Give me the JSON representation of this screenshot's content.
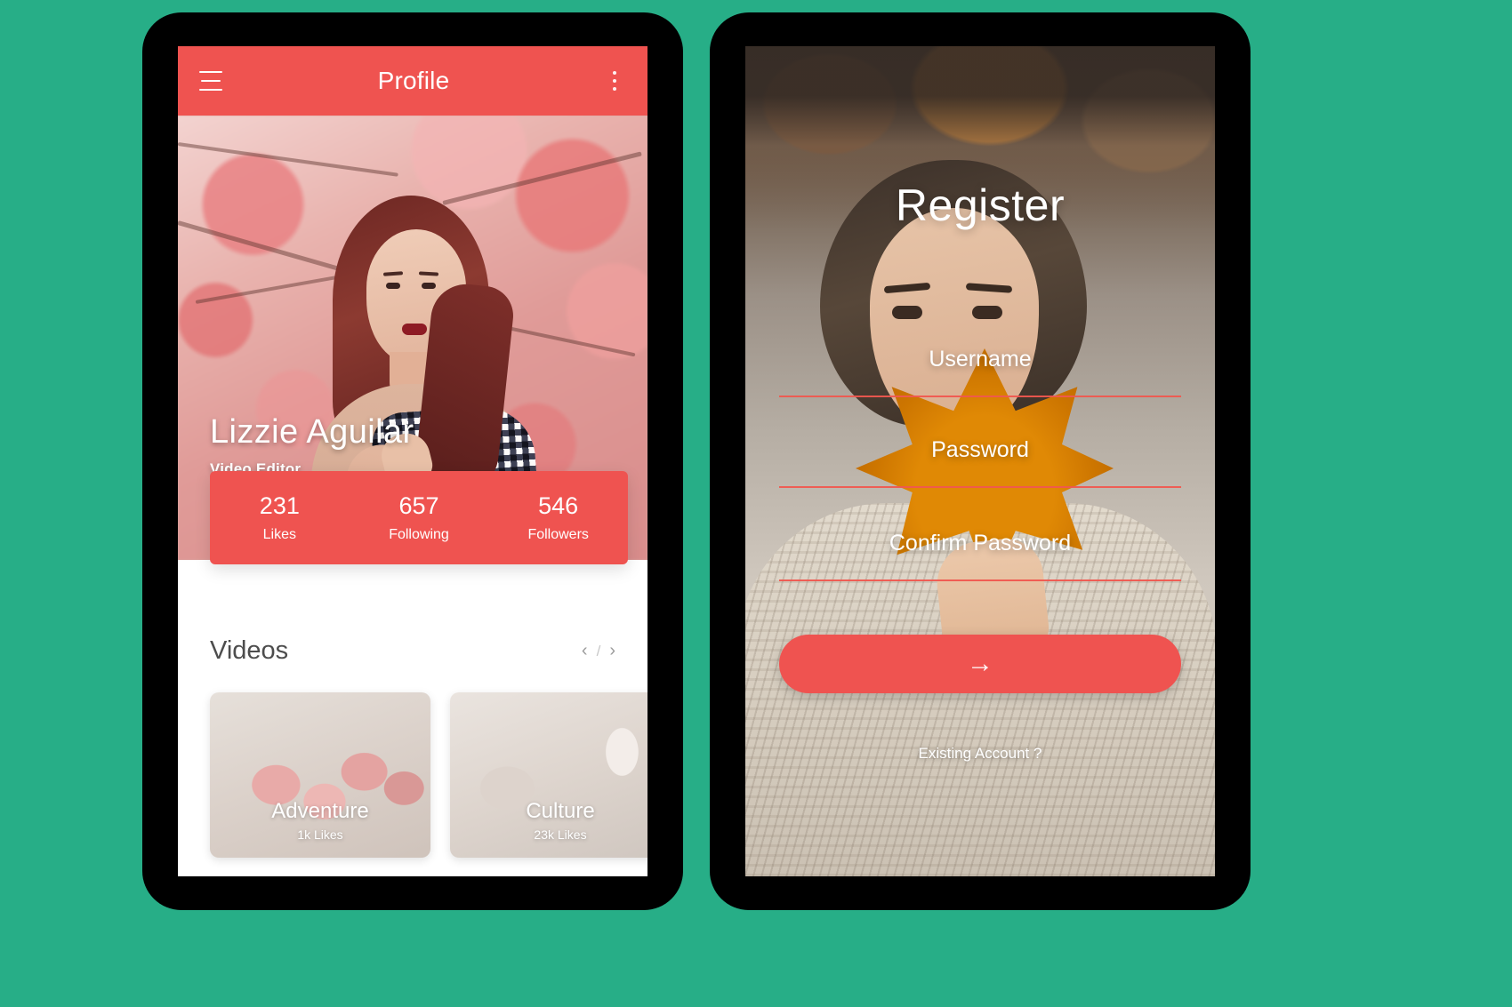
{
  "background_color": "#27ae87",
  "accent_color": "#ef5350",
  "profile_screen": {
    "appbar": {
      "menu_icon": "hamburger-menu-icon",
      "title": "Profile",
      "overflow_icon": "more-vertical-icon"
    },
    "hero": {
      "name": "Lizzie Aguilar",
      "role": "Video Editor"
    },
    "stats": [
      {
        "value": "231",
        "label": "Likes"
      },
      {
        "value": "657",
        "label": "Following"
      },
      {
        "value": "546",
        "label": "Followers"
      }
    ],
    "videos": {
      "title": "Videos",
      "prev": "‹",
      "separator": "/",
      "next": "›",
      "cards": [
        {
          "title": "Adventure",
          "likes": "1k Likes"
        },
        {
          "title": "Culture",
          "likes": "23k Likes"
        }
      ]
    }
  },
  "register_screen": {
    "title": "Register",
    "fields": [
      {
        "label": "Username"
      },
      {
        "label": "Password"
      },
      {
        "label": "Confirm Password"
      }
    ],
    "submit": {
      "icon": "arrow-right-icon",
      "glyph": "→"
    },
    "existing_account": "Existing Account ?"
  }
}
